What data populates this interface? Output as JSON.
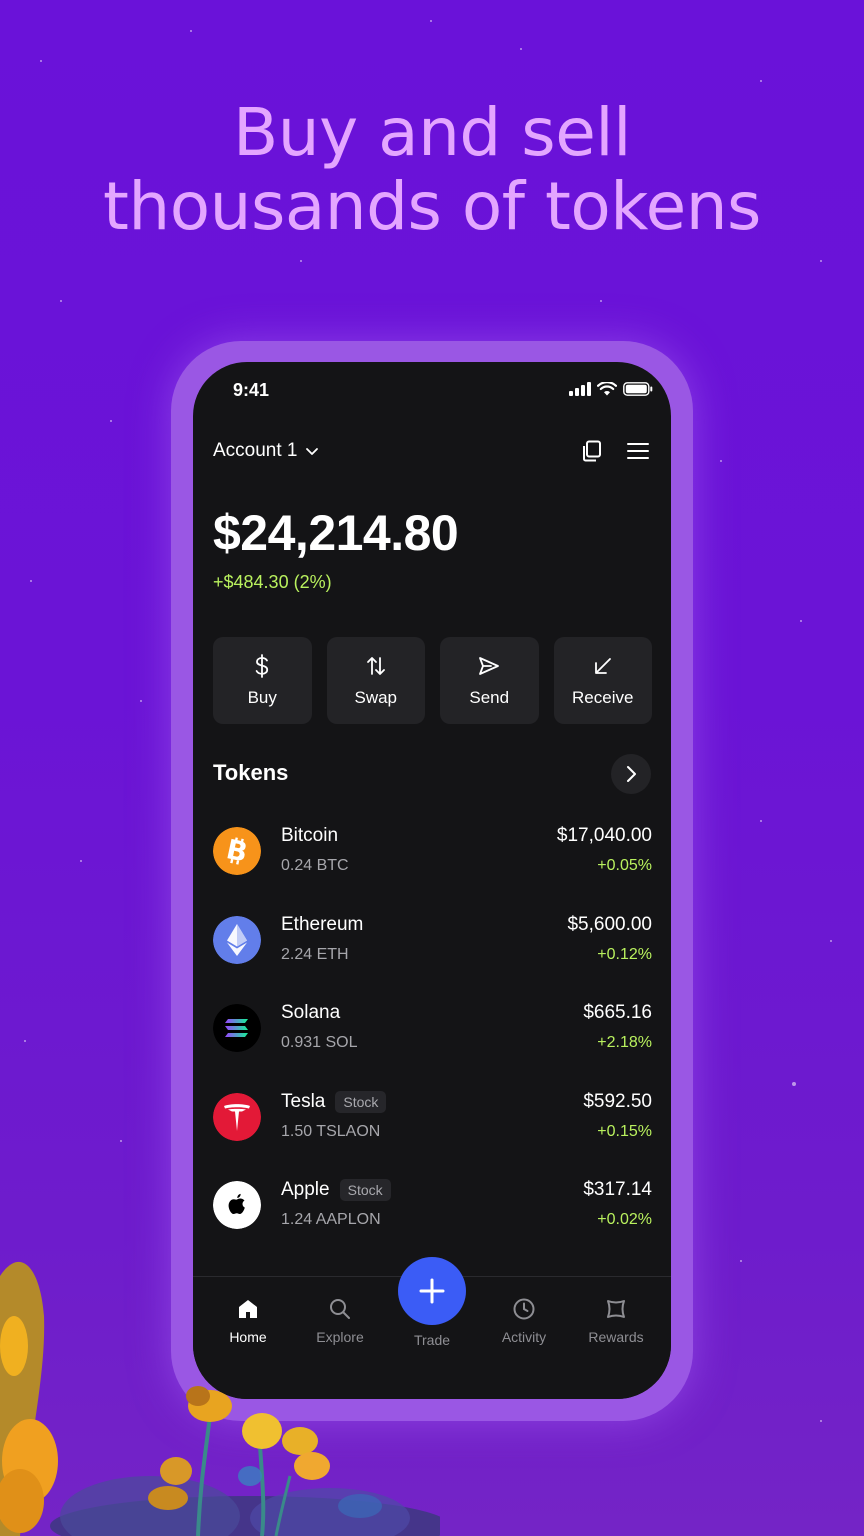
{
  "headline": {
    "line1": "Buy and sell",
    "line2": "thousands of tokens"
  },
  "status_bar": {
    "time": "9:41"
  },
  "account": {
    "name": "Account 1"
  },
  "balance": {
    "total": "$24,214.80",
    "change": "+$484.30 (2%)"
  },
  "quick_actions": [
    {
      "label": "Buy",
      "icon": "dollar-icon"
    },
    {
      "label": "Swap",
      "icon": "swap-arrows-icon"
    },
    {
      "label": "Send",
      "icon": "send-icon"
    },
    {
      "label": "Receive",
      "icon": "receive-arrow-icon"
    }
  ],
  "tokens": {
    "title": "Tokens",
    "items": [
      {
        "name": "Bitcoin",
        "amount": "0.24 BTC",
        "value": "$17,040.00",
        "change": "+0.05%",
        "badge": "",
        "icon": "bitcoin-icon",
        "color": "#f7931a"
      },
      {
        "name": "Ethereum",
        "amount": "2.24 ETH",
        "value": "$5,600.00",
        "change": "+0.12%",
        "badge": "",
        "icon": "ethereum-icon",
        "color": "#627eea"
      },
      {
        "name": "Solana",
        "amount": "0.931 SOL",
        "value": "$665.16",
        "change": "+2.18%",
        "badge": "",
        "icon": "solana-icon",
        "color": "#000000"
      },
      {
        "name": "Tesla",
        "amount": "1.50 TSLAON",
        "value": "$592.50",
        "change": "+0.15%",
        "badge": "Stock",
        "icon": "tesla-icon",
        "color": "#e31937"
      },
      {
        "name": "Apple",
        "amount": "1.24 AAPLON",
        "value": "$317.14",
        "change": "+0.02%",
        "badge": "Stock",
        "icon": "apple-icon",
        "color": "#ffffff"
      }
    ]
  },
  "nav": {
    "home": "Home",
    "explore": "Explore",
    "trade": "Trade",
    "activity": "Activity",
    "rewards": "Rewards"
  },
  "colors": {
    "background": "#6a12d9",
    "headline": "#e4a6ff",
    "positive": "#b9f15e",
    "accent": "#3b5cf6"
  }
}
